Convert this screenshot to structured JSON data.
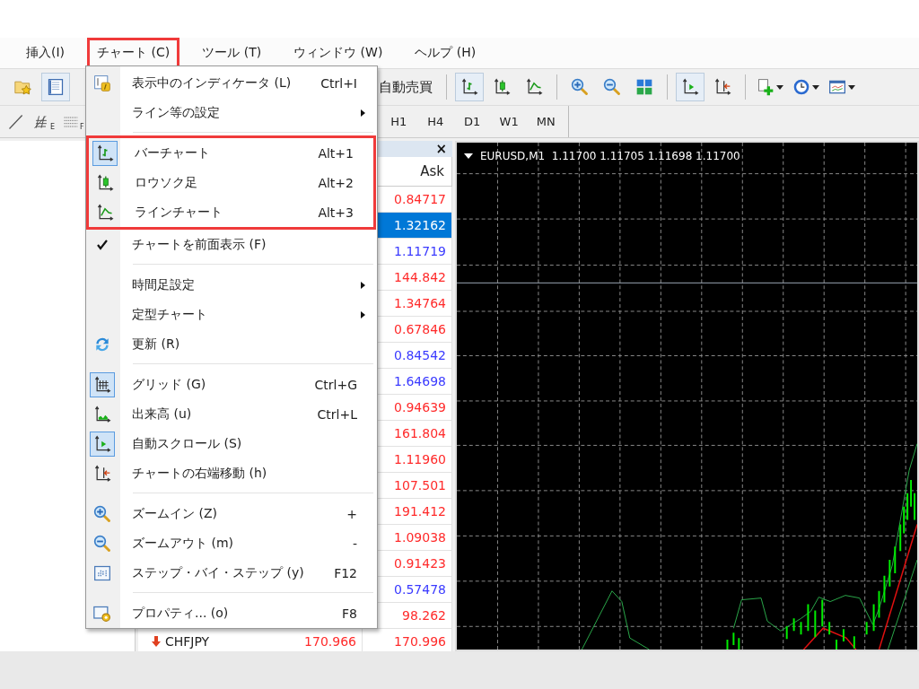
{
  "menubar": [
    {
      "label": "挿入(I)",
      "annotated": false
    },
    {
      "label": "チャート (C)",
      "annotated": true
    },
    {
      "label": "ツール (T)",
      "annotated": false
    },
    {
      "label": "ウィンドウ (W)",
      "annotated": false
    },
    {
      "label": "ヘルプ (H)",
      "annotated": false
    }
  ],
  "toolbar": {
    "left": [
      {
        "kind": "folder-star",
        "selected": false
      },
      {
        "kind": "panel-list",
        "selected": true
      }
    ],
    "autotrade": "自動売買",
    "groups": [
      [
        {
          "kind": "bar",
          "selected": true
        },
        {
          "kind": "candle",
          "selected": false
        },
        {
          "kind": "line",
          "selected": false
        }
      ],
      [
        {
          "kind": "zoom-in",
          "selected": false
        },
        {
          "kind": "zoom-out",
          "selected": false
        },
        {
          "kind": "tile",
          "selected": false
        }
      ],
      [
        {
          "kind": "autoscroll",
          "selected": true
        },
        {
          "kind": "shift",
          "selected": false
        }
      ],
      [
        {
          "kind": "new-chart",
          "selected": false,
          "dropdown": true
        },
        {
          "kind": "clock",
          "selected": false,
          "dropdown": true
        },
        {
          "kind": "template",
          "selected": false,
          "dropdown": true
        }
      ]
    ]
  },
  "drawing_tools": [
    {
      "kind": "trendline"
    },
    {
      "kind": "fibo",
      "letter": "E"
    },
    {
      "kind": "fibo-dotted",
      "letter": "F"
    }
  ],
  "timeframes": [
    "H1",
    "H4",
    "D1",
    "W1",
    "MN"
  ],
  "menu": {
    "sections": [
      {
        "divider": false,
        "annotated": false,
        "items": [
          {
            "kind": "indicator",
            "label": "表示中のインディケータ (L)",
            "shortcut": "Ctrl+I",
            "submenu": false,
            "checked": false
          },
          {
            "kind": "plain",
            "label": "ライン等の設定",
            "submenu": true,
            "checked": false
          }
        ]
      },
      {
        "divider": true,
        "annotated": true,
        "items": [
          {
            "kind": "bar",
            "label": "バーチャート",
            "shortcut": "Alt+1",
            "submenu": false,
            "checked": true
          },
          {
            "kind": "candle",
            "label": "ロウソク足",
            "shortcut": "Alt+2",
            "submenu": false,
            "checked": false
          },
          {
            "kind": "line",
            "label": "ラインチャート",
            "shortcut": "Alt+3",
            "submenu": false,
            "checked": false
          }
        ]
      },
      {
        "divider": false,
        "annotated": false,
        "items": [
          {
            "kind": "plain",
            "label": "チャートを前面表示 (F)",
            "submenu": false,
            "checked": true
          }
        ]
      },
      {
        "divider": true,
        "annotated": false,
        "items": [
          {
            "kind": "plain",
            "label": "時間足設定",
            "submenu": true,
            "checked": false
          },
          {
            "kind": "plain",
            "label": "定型チャート",
            "submenu": true,
            "checked": false
          },
          {
            "kind": "refresh",
            "label": "更新 (R)",
            "submenu": false,
            "checked": false
          }
        ]
      },
      {
        "divider": true,
        "annotated": false,
        "items": [
          {
            "kind": "grid",
            "label": "グリッド (G)",
            "shortcut": "Ctrl+G",
            "submenu": false,
            "checked": true
          },
          {
            "kind": "volume",
            "label": "出来高 (u)",
            "shortcut": "Ctrl+L",
            "submenu": false,
            "checked": false
          },
          {
            "kind": "autoscroll",
            "label": "自動スクロール (S)",
            "submenu": false,
            "checked": true
          },
          {
            "kind": "shift",
            "label": "チャートの右端移動 (h)",
            "submenu": false,
            "checked": false
          }
        ]
      },
      {
        "divider": true,
        "annotated": false,
        "items": [
          {
            "kind": "zoom-in",
            "label": "ズームイン (Z)",
            "shortcut": "+",
            "submenu": false,
            "checked": false
          },
          {
            "kind": "zoom-out",
            "label": "ズームアウト (m)",
            "shortcut": "-",
            "submenu": false,
            "checked": false
          },
          {
            "kind": "step",
            "label": "ステップ・バイ・ステップ (y)",
            "shortcut": "F12",
            "submenu": false,
            "checked": false
          }
        ]
      },
      {
        "divider": true,
        "annotated": false,
        "items": [
          {
            "kind": "properties",
            "label": "プロパティ... (o)",
            "shortcut": "F8",
            "submenu": false,
            "checked": false
          }
        ]
      }
    ]
  },
  "market_watch": {
    "close": "×",
    "columns": [
      "Ask"
    ],
    "rows": [
      {
        "ask": "0.84717",
        "color": "#ff2a2a",
        "selected": false
      },
      {
        "ask": "1.32162",
        "selected": true
      },
      {
        "ask": "1.11719",
        "color": "#3a3aff",
        "selected": false
      },
      {
        "ask": "144.842",
        "color": "#ff2a2a",
        "selected": false
      },
      {
        "ask": "1.34764",
        "color": "#ff2a2a",
        "selected": false
      },
      {
        "ask": "0.67846",
        "color": "#ff2a2a",
        "selected": false
      },
      {
        "ask": "0.84542",
        "color": "#3a3aff",
        "selected": false
      },
      {
        "ask": "1.64698",
        "color": "#3a3aff",
        "selected": false
      },
      {
        "ask": "0.94639",
        "color": "#ff2a2a",
        "selected": false
      },
      {
        "ask": "161.804",
        "color": "#ff2a2a",
        "selected": false
      },
      {
        "ask": "1.11960",
        "color": "#ff2a2a",
        "selected": false
      },
      {
        "ask": "107.501",
        "color": "#ff2a2a",
        "selected": false
      },
      {
        "ask": "191.412",
        "color": "#ff2a2a",
        "selected": false
      },
      {
        "ask": "1.09038",
        "color": "#ff2a2a",
        "selected": false
      },
      {
        "ask": "0.91423",
        "color": "#ff2a2a",
        "selected": false
      },
      {
        "ask": "0.57478",
        "color": "#3a3aff",
        "selected": false
      },
      {
        "ask": "98.262",
        "color": "#ff2a2a",
        "selected": false
      },
      {
        "symbol": "CHFJPY",
        "falling": true,
        "bid": "170.966",
        "ask": "170.996",
        "color": "#ff2a2a",
        "selected": false
      }
    ]
  },
  "chart": {
    "title": "EURUSD,M1  1.11700 1.11705 1.11698 1.11700"
  }
}
